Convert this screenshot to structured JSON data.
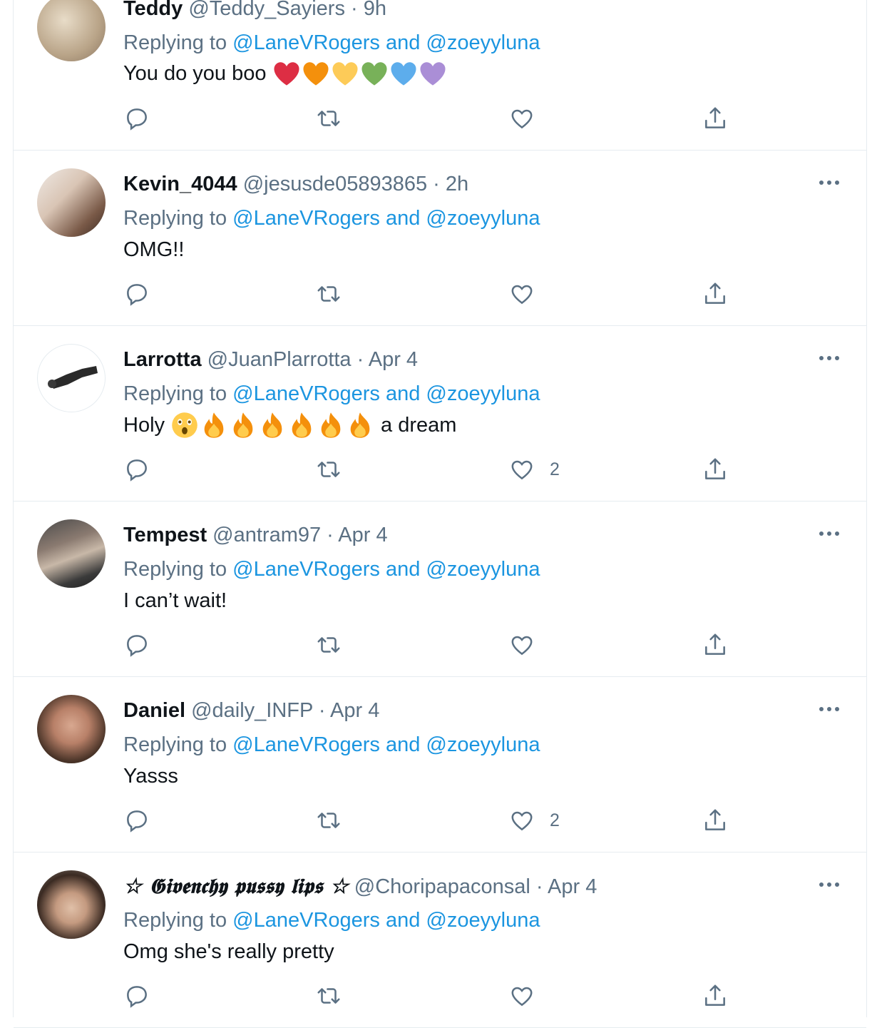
{
  "tweets": [
    {
      "name": "Teddy",
      "handle": "@Teddy_Sayiers",
      "dot": " · ",
      "time": "9h",
      "replying_prefix": "Replying to ",
      "replying_to": "@LaneVRogers and @zoeyyluna",
      "text": "You do you boo",
      "emojis": [
        "red-heart",
        "orange-heart",
        "yellow-heart",
        "green-heart",
        "blue-heart",
        "purple-heart"
      ],
      "like_count": ""
    },
    {
      "name": "Kevin_4044",
      "handle": "@jesusde05893865",
      "dot": " · ",
      "time": "2h",
      "replying_prefix": "Replying to ",
      "replying_to": "@LaneVRogers and @zoeyyluna",
      "text": "OMG!!",
      "like_count": ""
    },
    {
      "name": "Larrotta",
      "handle": "@JuanPlarrotta",
      "dot": " · ",
      "time": "Apr 4",
      "replying_prefix": "Replying to ",
      "replying_to": "@LaneVRogers and @zoeyyluna",
      "text": "Holy",
      "text_after": "a dream",
      "emojis": [
        "astonished-face",
        "fire",
        "fire",
        "fire",
        "fire",
        "fire",
        "fire"
      ],
      "like_count": "2"
    },
    {
      "name": "Tempest",
      "handle": "@antram97",
      "dot": " · ",
      "time": "Apr 4",
      "replying_prefix": "Replying to ",
      "replying_to": "@LaneVRogers and @zoeyyluna",
      "text": "I can’t wait!",
      "like_count": ""
    },
    {
      "name": "Daniel",
      "handle": "@daily_INFP",
      "dot": " · ",
      "time": "Apr 4",
      "replying_prefix": "Replying to ",
      "replying_to": "@LaneVRogers and @zoeyyluna",
      "text": "Yasss",
      "like_count": "2"
    },
    {
      "name": "☆ 𝕲𝖎𝖛𝖊𝖓𝖈𝖍𝖞 𝖕𝖚𝖘𝖘𝖞 𝖑𝖎𝖕𝖘 ☆",
      "handle": "@Choripapaconsal",
      "dot": " · ",
      "time": "Apr 4",
      "replying_prefix": "Replying to ",
      "replying_to": "@LaneVRogers and @zoeyyluna",
      "text": "Omg she's really pretty",
      "like_count": ""
    }
  ],
  "colors": {
    "link": "#1b95e0",
    "secondary": "#5b7083",
    "primary": "#0f1419",
    "divider": "#e6ecf0"
  },
  "icons": {
    "reply": "reply-icon",
    "retweet": "retweet-icon",
    "like": "like-icon",
    "share": "share-icon",
    "more": "more-icon"
  }
}
